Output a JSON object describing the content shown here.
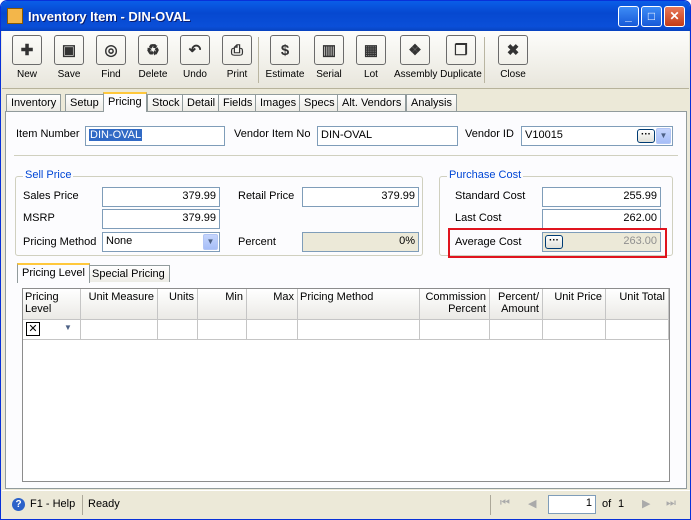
{
  "window": {
    "title": "Inventory Item - DIN-OVAL",
    "min": "_",
    "max": "□",
    "close": "✕"
  },
  "toolbar": [
    {
      "label": "New",
      "icon": "new-icon",
      "glyph": "✚"
    },
    {
      "label": "Save",
      "icon": "save-icon",
      "glyph": "▣"
    },
    {
      "label": "Find",
      "icon": "binoculars-icon",
      "glyph": "◎"
    },
    {
      "label": "Delete",
      "icon": "recycle-bin-icon",
      "glyph": "♻"
    },
    {
      "label": "Undo",
      "icon": "undo-icon",
      "glyph": "↶"
    },
    {
      "label": "Print",
      "icon": "printer-icon",
      "glyph": "⎙"
    },
    {
      "label": "Estimate",
      "icon": "estimate-icon",
      "glyph": "$"
    },
    {
      "label": "Serial",
      "icon": "barcode-icon",
      "glyph": "▥"
    },
    {
      "label": "Lot",
      "icon": "lot-box-icon",
      "glyph": "▦"
    },
    {
      "label": "Assembly",
      "icon": "assembly-icon",
      "glyph": "❖"
    },
    {
      "label": "Duplicate",
      "icon": "duplicate-icon",
      "glyph": "❐"
    },
    {
      "label": "Close",
      "icon": "close-doc-icon",
      "glyph": "✖"
    }
  ],
  "tabs": [
    "Inventory",
    "Setup",
    "Pricing",
    "Stock",
    "Detail",
    "Fields",
    "Images",
    "Specs",
    "Alt. Vendors",
    "Analysis"
  ],
  "active_tab": "Pricing",
  "header": {
    "item_number_label": "Item Number",
    "item_number": "DIN-OVAL",
    "vendor_item_label": "Vendor Item No",
    "vendor_item": "DIN-OVAL",
    "vendor_id_label": "Vendor ID",
    "vendor_id": "V10015"
  },
  "sell_price": {
    "title": "Sell Price",
    "sales_price_label": "Sales Price",
    "sales_price": "379.99",
    "retail_price_label": "Retail Price",
    "retail_price": "379.99",
    "msrp_label": "MSRP",
    "msrp": "379.99",
    "pricing_method_label": "Pricing Method",
    "pricing_method": "None",
    "percent_label": "Percent",
    "percent": "0%"
  },
  "purchase_cost": {
    "title": "Purchase Cost",
    "standard_cost_label": "Standard Cost",
    "standard_cost": "255.99",
    "last_cost_label": "Last Cost",
    "last_cost": "262.00",
    "average_cost_label": "Average Cost",
    "average_cost": "263.00",
    "highlight_color": "#e0141e"
  },
  "subtabs": [
    "Pricing Level",
    "Special Pricing"
  ],
  "grid_columns": [
    "Pricing Level",
    "Unit Measure",
    "Units",
    "Min",
    "Max",
    "Pricing Method",
    "Commission Percent",
    "Percent/ Amount",
    "Unit Price",
    "Unit Total"
  ],
  "status": {
    "help": "F1 - Help",
    "state": "Ready",
    "page": "1",
    "of": "of",
    "total": "1"
  }
}
